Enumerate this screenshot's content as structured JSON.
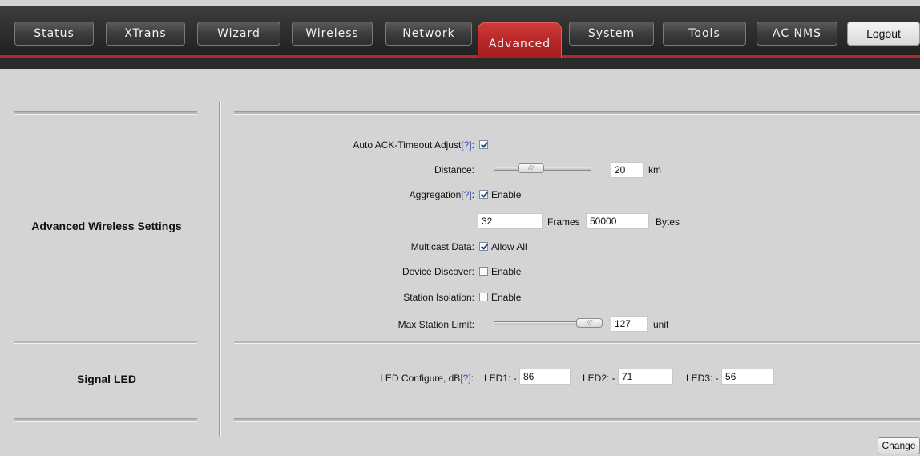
{
  "nav": {
    "tabs": [
      {
        "label": "Status"
      },
      {
        "label": "XTrans"
      },
      {
        "label": "Wizard"
      },
      {
        "label": "Wireless"
      },
      {
        "label": "Network"
      },
      {
        "label": "Advanced"
      },
      {
        "label": "System"
      },
      {
        "label": "Tools"
      },
      {
        "label": "AC NMS"
      }
    ],
    "active": "Advanced",
    "logout_label": "Logout"
  },
  "wireless": {
    "section_title": "Advanced Wireless Settings",
    "help_mark": "[?]",
    "ack_label": "Auto ACK-Timeout Adjust",
    "ack_checked": true,
    "distance_label": "Distance:",
    "distance_value": "20",
    "distance_unit": "km",
    "aggregation_label": "Aggregation",
    "aggregation_checked": true,
    "enable_text": "Enable",
    "frames_value": "32",
    "frames_label": "Frames",
    "bytes_value": "50000",
    "bytes_label": "Bytes",
    "multicast_label": "Multicast Data:",
    "multicast_checked": true,
    "multicast_text": "Allow All",
    "discover_label": "Device Discover:",
    "discover_checked": false,
    "isolation_label": "Station Isolation:",
    "isolation_checked": false,
    "maxsta_label": "Max Station Limit:",
    "maxsta_value": "127",
    "maxsta_unit": "unit"
  },
  "led": {
    "section_title": "Signal LED",
    "config_label": "LED Configure, dB",
    "led1_label": "LED1: -",
    "led1_value": "86",
    "led2_label": "LED2: -",
    "led2_value": "71",
    "led3_label": "LED3: -",
    "led3_value": "56"
  },
  "footer": {
    "change_label": "Change"
  },
  "colors": {
    "active_tab": "#b42525",
    "accent_line": "#b2262d",
    "help_link": "#3a4fb8"
  }
}
